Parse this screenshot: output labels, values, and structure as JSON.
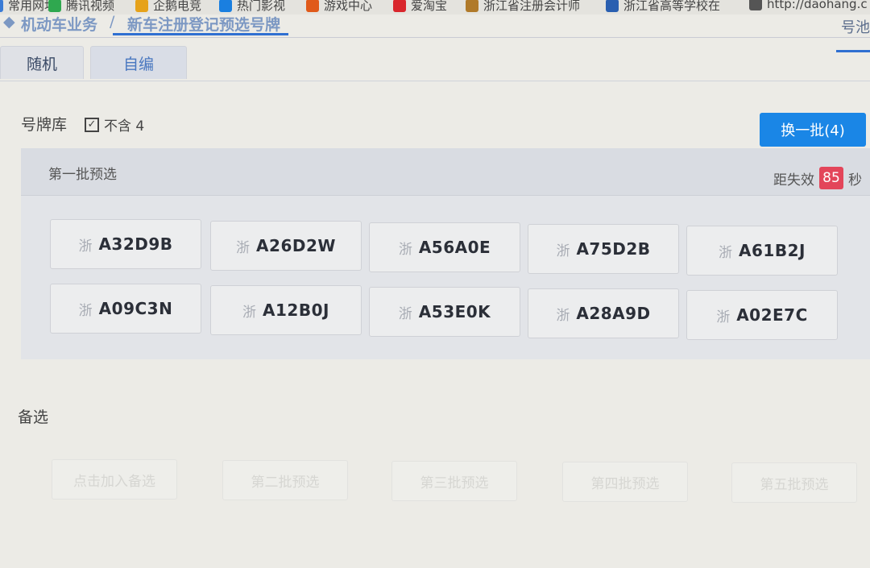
{
  "bookmarks": [
    {
      "label": "常用网址",
      "color": "#3a7bd5"
    },
    {
      "label": "腾讯视频",
      "color": "#2fa84f"
    },
    {
      "label": "企鹅电竞",
      "color": "#e6a21a"
    },
    {
      "label": "热门影视",
      "color": "#1a7fe0"
    },
    {
      "label": "游戏中心",
      "color": "#e05a1a"
    },
    {
      "label": "爱淘宝",
      "color": "#d9262c"
    },
    {
      "label": "浙江省注册会计师",
      "color": "#b07a2a"
    },
    {
      "label": "浙江省高等学校在",
      "color": "#2a5fb0"
    },
    {
      "label": "http://daohang.c",
      "color": "#555555"
    }
  ],
  "breadcrumb": {
    "parent": "机动车业务",
    "separator": "/",
    "current": "新车注册登记预选号牌"
  },
  "right_tab": "号池",
  "tabs": [
    {
      "label": "随机",
      "active": false
    },
    {
      "label": "自编",
      "active": true
    }
  ],
  "pool": {
    "label": "号牌库",
    "exclude_four_label": "不含 4",
    "exclude_four_checked": true,
    "refresh_button": "换一批(4)"
  },
  "batch": {
    "title": "第一批预选",
    "countdown_label": "距失效",
    "countdown_value": "85",
    "countdown_unit": "秒",
    "province": "浙",
    "plates": [
      "A32D9B",
      "A26D2W",
      "A56A0E",
      "A75D2B",
      "A61B2J",
      "A09C3N",
      "A12B0J",
      "A53E0K",
      "A28A9D",
      "A02E7C"
    ]
  },
  "alternates": {
    "label": "备选",
    "buttons": [
      "点击加入备选",
      "第二批预选",
      "第三批预选",
      "第四批预选",
      "第五批预选"
    ]
  },
  "colors": {
    "accent_blue": "#1a86e6",
    "badge_red": "#e3455a"
  }
}
